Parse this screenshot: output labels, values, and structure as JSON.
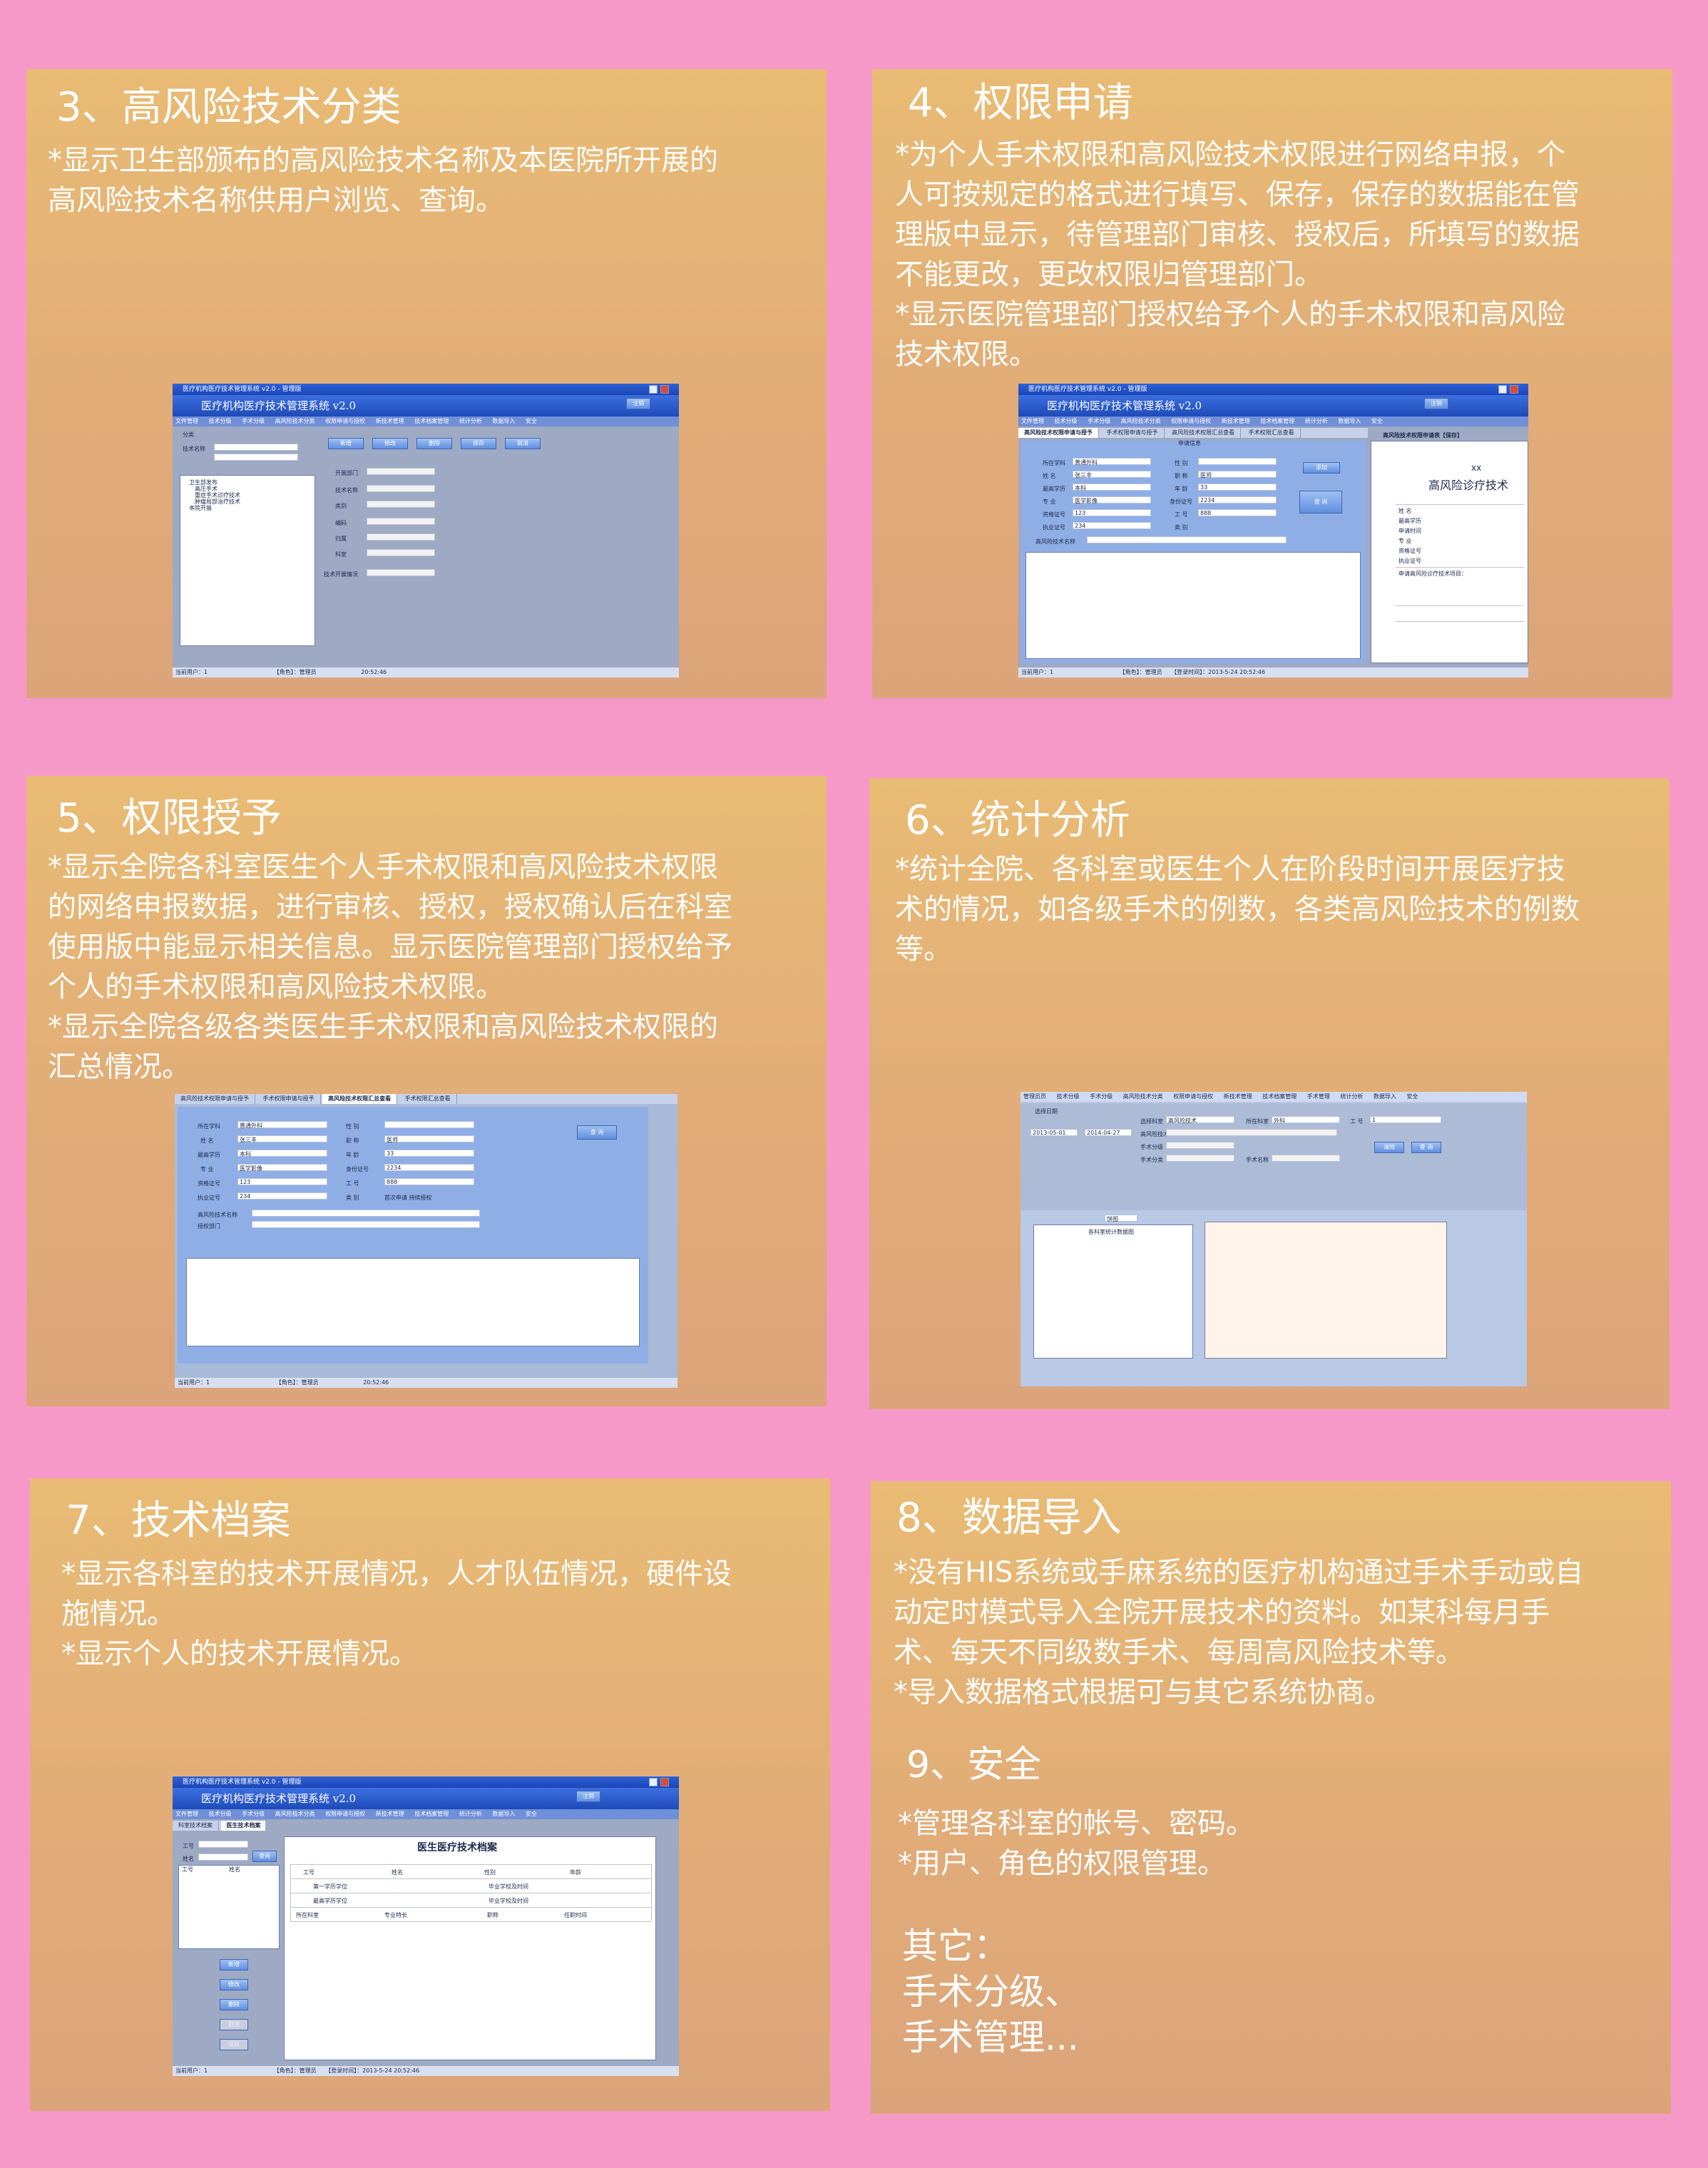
{
  "colors": {
    "page_background": "#f799c8",
    "panel": "#e4b177",
    "panel_text": "#ffffff",
    "app_blue": "#2d62d8"
  },
  "panels": {
    "p3": {
      "title": "3、高风险技术分类",
      "lines": [
        "*显示卫生部颁布的高风险技术名称及本医院所开展的",
        "高风险技术名称供用户浏览、查询。"
      ]
    },
    "p4": {
      "title": "4、权限申请",
      "lines": [
        "*为个人手术权限和高风险技术权限进行网络申报，个",
        "人可按规定的格式进行填写、保存，保存的数据能在管",
        "理版中显示，待管理部门审核、授权后，所填写的数据",
        "不能更改，更改权限归管理部门。",
        "*显示医院管理部门授权给予个人的手术权限和高风险",
        "技术权限。"
      ]
    },
    "p5": {
      "title": "5、权限授予",
      "lines": [
        "*显示全院各科室医生个人手术权限和高风险技术权限",
        "的网络申报数据，进行审核、授权，授权确认后在科室",
        "使用版中能显示相关信息。显示医院管理部门授权给予",
        "个人的手术权限和高风险技术权限。",
        "*显示全院各级各类医生手术权限和高风险技术权限的",
        "汇总情况。"
      ]
    },
    "p6": {
      "title": "6、统计分析",
      "lines": [
        "*统计全院、各科室或医生个人在阶段时间开展医疗技",
        "术的情况，如各级手术的例数，各类高风险技术的例数",
        "等。"
      ]
    },
    "p7": {
      "title": "7、技术档案",
      "lines": [
        "*显示各科室的技术开展情况，人才队伍情况，硬件设",
        "施情况。",
        "*显示个人的技术开展情况。"
      ]
    },
    "p8": {
      "title": "8、数据导入",
      "lines": [
        "*没有HIS系统或手麻系统的医疗机构通过手术手动或自",
        "动定时模式导入全院开展技术的资料。如某科每月手",
        "术、每天不同级数手术、每周高风险技术等。",
        "*导入数据格式根据可与其它系统协商。"
      ],
      "security_title": "9、安全",
      "security_lines": [
        "*管理各科室的帐号、密码。",
        "*用户、角色的权限管理。"
      ],
      "other_lines": [
        "其它：",
        "手术分级、",
        "手术管理..."
      ]
    }
  },
  "app": {
    "window_title": "医疗机构医疗技术管理系统 v2.0 - 管理版",
    "banner": "医疗机构医疗技术管理系统 v2.0",
    "login_btn": "注销",
    "menu": [
      "文件管理",
      "技术分级",
      "手术分级",
      "高风险技术分类",
      "权限申请与授权",
      "新技术管理",
      "技术档案管理",
      "统计分析",
      "数据导入",
      "安全"
    ],
    "status_user": "当前用户：1",
    "status_role": "【角色】：管理员",
    "status_time_label": "【登录时间】：2013-5-24 20:52:46",
    "status_clock": "20:52:46",
    "s3": {
      "search_label": "技术名称",
      "group": "分类",
      "tree": [
        "卫生部发布",
        "  高压手术",
        "  重症手术诊疗技术",
        "  肿瘤局部治疗技术",
        "本院开展"
      ],
      "buttons": [
        "新增",
        "修改",
        "删除",
        "保存",
        "取消"
      ],
      "fields": [
        "开展部门",
        "技术名称",
        "类别",
        "编码",
        "归属",
        "科室",
        "技术开展情况"
      ]
    },
    "s4": {
      "tabs": [
        "高风险技术权限申请与授予",
        "手术权限申请与授予",
        "高风险技术权限汇总查看",
        "手术权限汇总查看"
      ],
      "section": "申请信息",
      "fields_left": [
        "所在学科",
        "姓 名",
        "最高学历",
        "专 业",
        "资格证号",
        "执业证号",
        "高风险技术名称"
      ],
      "values_left": [
        "普通外科",
        "张三丰",
        "本科",
        "医学影像",
        "123",
        "234",
        ""
      ],
      "fields_right": [
        "性 别",
        "职 称",
        "年 龄",
        "身份证号",
        "工 号",
        "类 别"
      ],
      "values_right": [
        "",
        "医师",
        "33",
        "2234",
        "888",
        ""
      ],
      "apply_btn": "添加",
      "query_btn": "查 询",
      "doc_title": "xx",
      "doc_subtitle": "高风险诊疗技术",
      "doc_right_tab": "高风险技术权限申请表【保存】",
      "doc_rows": [
        "姓 名",
        "最高学历",
        "申请时间",
        "专 业",
        "资格证号",
        "执业证号",
        "申请高风险诊疗技术项目："
      ]
    },
    "s5": {
      "tabs": [
        "高风险技术权限申请与授予",
        "手术权限申请与授予",
        "高风险技术权限汇总查看",
        "手术权限汇总查看"
      ],
      "fields_left": [
        "所在学科",
        "姓 名",
        "最高学历",
        "专 业",
        "资格证号",
        "执业证号",
        "高风险技术名称",
        "授权部门"
      ],
      "values_left": [
        "普通外科",
        "张三丰",
        "本科",
        "医学影像",
        "123",
        "234",
        "",
        ""
      ],
      "fields_right": [
        "性 别",
        "职 称",
        "年 龄",
        "身份证号",
        "工 号",
        "类 别"
      ],
      "values_right": [
        "",
        "医师",
        "33",
        "2234",
        "888",
        "首次申请  持续授权"
      ],
      "query_btn": "查 询"
    },
    "s6": {
      "menu": [
        "管理员页",
        "技术分级",
        "手术分级",
        "高风险技术分类",
        "权限申请与授权",
        "新技术管理",
        "技术档案管理",
        "手术管理",
        "统计分析",
        "数据导入",
        "安全"
      ],
      "group": "选择日期",
      "date_from": "2013-05-01",
      "date_to": "2014-04-27",
      "labels": [
        "选择科室",
        "高风险技术",
        "手术分级",
        "手术分类",
        "所在科室",
        "工 号",
        "手术名称"
      ],
      "values": [
        "高风险技术",
        "外科",
        "1"
      ],
      "buttons": [
        "清除",
        "查 询"
      ],
      "dropdown": "饼图",
      "list_title": "各科室统计数据图"
    },
    "s7": {
      "tabs": [
        "科室技术档案",
        "医生技术档案"
      ],
      "search_labels": [
        "工号",
        "姓名"
      ],
      "search_btn": "查询",
      "list_header": [
        "工号",
        "姓名"
      ],
      "buttons": [
        "新增",
        "修改",
        "删除",
        "取消",
        "保存"
      ],
      "doc_title": "医生医疗技术档案",
      "doc_row1": [
        "工号",
        "姓名",
        "性别",
        "年龄"
      ],
      "doc_row2": [
        "第一学历学位",
        "毕业学校及时间"
      ],
      "doc_row3": [
        "最高学历学位",
        "毕业学校及时间"
      ],
      "doc_row4": [
        "所在科室",
        "专业特长",
        "职称",
        "任职时间"
      ]
    }
  }
}
